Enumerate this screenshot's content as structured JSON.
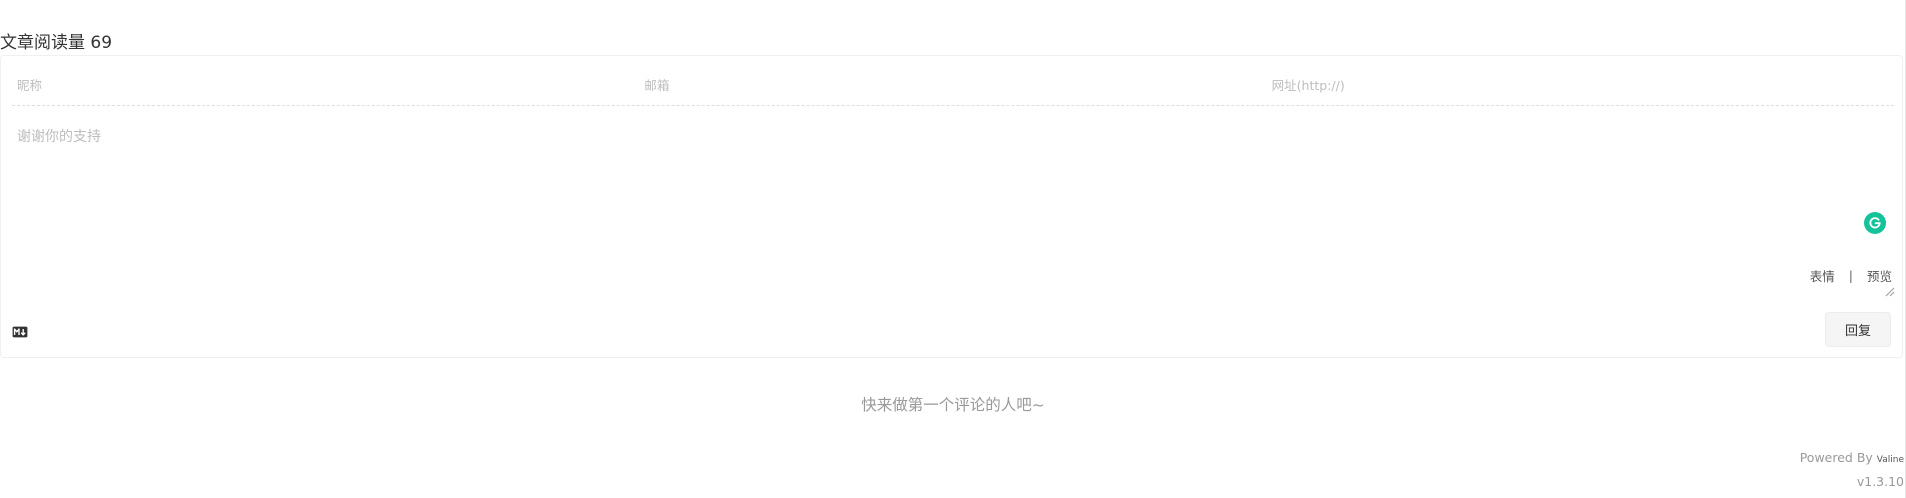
{
  "read_count": {
    "label": "文章阅读量",
    "value": "69"
  },
  "comment_form": {
    "nickname_placeholder": "昵称",
    "email_placeholder": "邮箱",
    "website_placeholder": "网址(http://)",
    "comment_placeholder": "谢谢你的支持",
    "emoji_label": "表情",
    "separator": "|",
    "preview_label": "预览",
    "reply_label": "回复",
    "grammarly_icon": "grammarly-icon",
    "markdown_icon": "markdown-icon"
  },
  "empty_message": "快来做第一个评论的人吧~",
  "footer": {
    "powered_by": "Powered By",
    "brand": "Valine",
    "version": "v1.3.10"
  },
  "colors": {
    "grammarly_green": "#15c39a",
    "muted_text": "#999999",
    "placeholder_text": "#bdbdbd",
    "button_background": "#f5f5f5"
  }
}
